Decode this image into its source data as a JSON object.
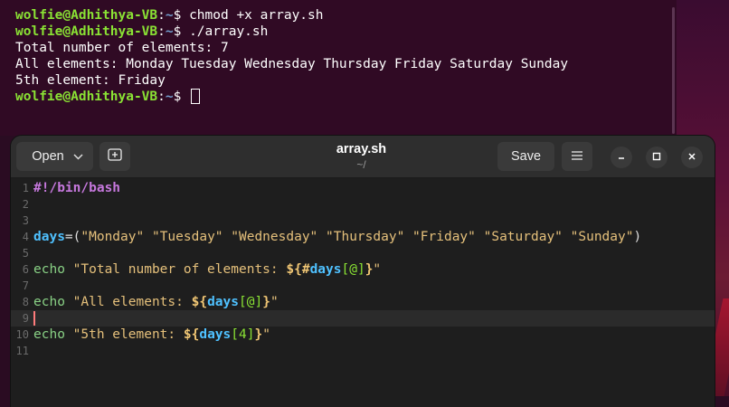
{
  "terminal": {
    "prompt_user": "wolfie@Adhithya-VB",
    "prompt_path": "~",
    "prompt_symbol": "$",
    "lines": [
      {
        "type": "cmd",
        "command": "chmod +x array.sh"
      },
      {
        "type": "cmd",
        "command": "./array.sh"
      },
      {
        "type": "out",
        "text": "Total number of elements: 7"
      },
      {
        "type": "out",
        "text": "All elements: Monday Tuesday Wednesday Thursday Friday Saturday Sunday"
      },
      {
        "type": "out",
        "text": "5th element: Friday"
      },
      {
        "type": "prompt",
        "command": ""
      }
    ]
  },
  "editor": {
    "open_label": "Open",
    "save_label": "Save",
    "title": "array.sh",
    "subtitle": "~/",
    "current_line": 9,
    "lines": [
      {
        "n": "1",
        "tokens": [
          {
            "c": "comment",
            "t": "#!/bin/bash"
          }
        ]
      },
      {
        "n": "2",
        "tokens": []
      },
      {
        "n": "3",
        "tokens": []
      },
      {
        "n": "4",
        "tokens": [
          {
            "c": "var",
            "t": "days"
          },
          {
            "c": "op",
            "t": "=("
          },
          {
            "c": "str",
            "t": "\"Monday\" \"Tuesday\" \"Wednesday\" \"Thursday\" \"Friday\" \"Saturday\" \"Sunday\""
          },
          {
            "c": "op",
            "t": ")"
          }
        ]
      },
      {
        "n": "5",
        "tokens": []
      },
      {
        "n": "6",
        "tokens": [
          {
            "c": "cmd",
            "t": "echo "
          },
          {
            "c": "str",
            "t": "\"Total number of elements: "
          },
          {
            "c": "exp",
            "t": "${#"
          },
          {
            "c": "var",
            "t": "days"
          },
          {
            "c": "idx",
            "t": "[@]"
          },
          {
            "c": "exp",
            "t": "}"
          },
          {
            "c": "str",
            "t": "\""
          }
        ]
      },
      {
        "n": "7",
        "tokens": []
      },
      {
        "n": "8",
        "tokens": [
          {
            "c": "cmd",
            "t": "echo "
          },
          {
            "c": "str",
            "t": "\"All elements: "
          },
          {
            "c": "exp",
            "t": "${"
          },
          {
            "c": "var",
            "t": "days"
          },
          {
            "c": "idx",
            "t": "[@]"
          },
          {
            "c": "exp",
            "t": "}"
          },
          {
            "c": "str",
            "t": "\""
          }
        ]
      },
      {
        "n": "9",
        "tokens": []
      },
      {
        "n": "10",
        "tokens": [
          {
            "c": "cmd",
            "t": "echo "
          },
          {
            "c": "str",
            "t": "\"5th element: "
          },
          {
            "c": "exp",
            "t": "${"
          },
          {
            "c": "var",
            "t": "days"
          },
          {
            "c": "idx",
            "t": "[4]"
          },
          {
            "c": "exp",
            "t": "}"
          },
          {
            "c": "str",
            "t": "\""
          }
        ]
      },
      {
        "n": "11",
        "tokens": []
      }
    ]
  }
}
